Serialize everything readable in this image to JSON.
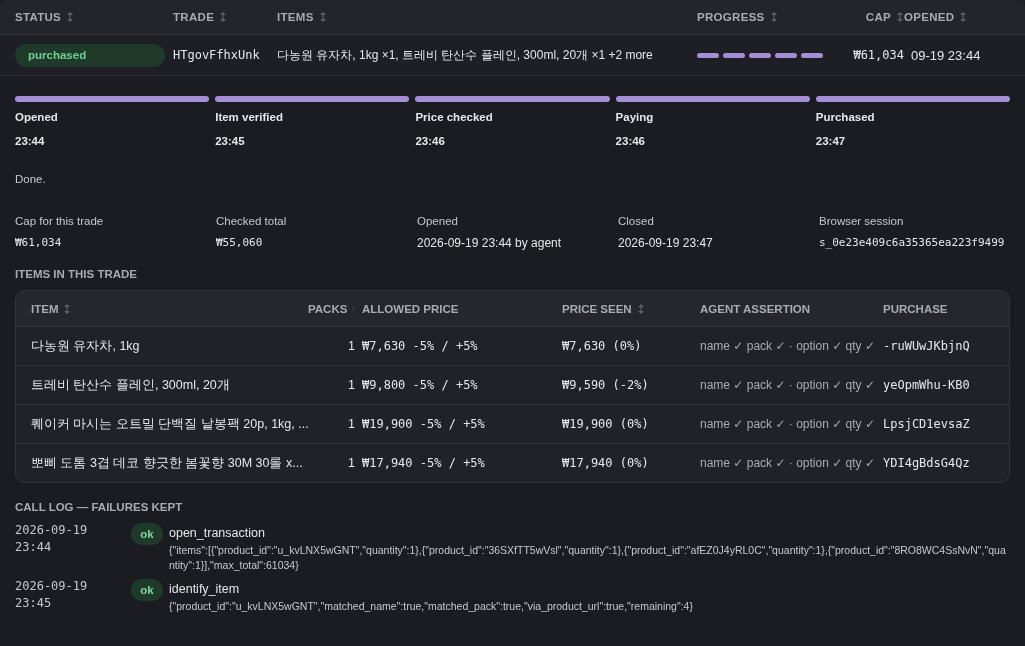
{
  "trades_table": {
    "columns": [
      {
        "label": "STATUS",
        "sortable": true
      },
      {
        "label": "TRADE",
        "sortable": true
      },
      {
        "label": "ITEMS",
        "sortable": true
      },
      {
        "label": "PROGRESS",
        "sortable": true
      },
      {
        "label": "CAP",
        "sortable": true
      },
      {
        "label": "OPENED",
        "sortable": true
      }
    ],
    "rows": [
      {
        "status": "purchased",
        "trade": "HTgovFfhxUnk",
        "items": "다농원 유자차, 1kg ×1, 트레비 탄산수 플레인, 300ml, 20개 ×1 +2 more",
        "progress": [
          {
            "done": true
          },
          {
            "done": true
          },
          {
            "done": true
          },
          {
            "done": true
          },
          {
            "done": true
          }
        ],
        "cap": "₩61,034",
        "opened": "09-19 23:44"
      }
    ]
  },
  "detail": {
    "steps": [
      {
        "label": "Opened",
        "time": "23:44",
        "done": true
      },
      {
        "label": "Item verified",
        "time": "23:45",
        "done": true
      },
      {
        "label": "Price checked",
        "time": "23:46",
        "done": true
      },
      {
        "label": "Paying",
        "time": "23:46",
        "done": true
      },
      {
        "label": "Purchased",
        "time": "23:47",
        "done": true
      }
    ],
    "message": "Done.",
    "facts": [
      {
        "label": "Cap for this trade",
        "value": "₩61,034",
        "mono": true
      },
      {
        "label": "Checked total",
        "value": "₩55,060",
        "mono": true
      },
      {
        "label": "Opened",
        "value": "2026-09-19 23:44 by agent",
        "mono": false
      },
      {
        "label": "Closed",
        "value": "2026-09-19 23:47",
        "mono": false
      },
      {
        "label": "Browser session",
        "value": "s_0e23e409c6a35365ea223f9499",
        "mono": true
      }
    ],
    "items_heading": "ITEMS IN THIS TRADE",
    "items_table": {
      "columns": [
        {
          "label": "ITEM",
          "sortable": true
        },
        {
          "label": "PACKS",
          "sortable": true
        },
        {
          "label": "ALLOWED PRICE",
          "sortable": false
        },
        {
          "label": "PRICE SEEN",
          "sortable": true
        },
        {
          "label": "AGENT ASSERTION",
          "sortable": false
        },
        {
          "label": "PURCHASE",
          "sortable": false
        }
      ],
      "rows": [
        {
          "item": "다농원 유자차, 1kg",
          "packs": "1",
          "allowed": "₩7,630 -5% / +5%",
          "seen": "₩7,630 (0%)",
          "assertion": "name ✓ pack ✓ · option ✓ qty ✓",
          "purchase": "-ruWUwJKbjnQ"
        },
        {
          "item": "트레비 탄산수 플레인, 300ml, 20개",
          "packs": "1",
          "allowed": "₩9,800 -5% / +5%",
          "seen": "₩9,590 (-2%)",
          "assertion": "name ✓ pack ✓ · option ✓ qty ✓",
          "purchase": "yeOpmWhu-KB0"
        },
        {
          "item": "퀘이커 마시는 오트밀 단백질 낱봉팩 20p, 1kg, ...",
          "packs": "1",
          "allowed": "₩19,900 -5% / +5%",
          "seen": "₩19,900 (0%)",
          "assertion": "name ✓ pack ✓ · option ✓ qty ✓",
          "purchase": "LpsjCD1evsaZ"
        },
        {
          "item": "뽀삐 도톰 3겹 데코 향긋한 봄꽃향 30M 30롤 x...",
          "packs": "1",
          "allowed": "₩17,940 -5% / +5%",
          "seen": "₩17,940 (0%)",
          "assertion": "name ✓ pack ✓ · option ✓ qty ✓",
          "purchase": "YDI4gBdsG4Qz"
        }
      ]
    },
    "log_heading": "CALL LOG — FAILURES KEPT",
    "log": [
      {
        "date": "2026-09-19",
        "time": "23:44",
        "result": "ok",
        "call": "open_transaction",
        "args": "{\"items\":[{\"product_id\":\"u_kvLNX5wGNT\",\"quantity\":1},{\"product_id\":\"36SXfTT5wVsl\",\"quantity\":1},{\"product_id\":\"afEZ0J4yRL0C\",\"quantity\":1},{\"product_id\":\"8RO8WC4SsNvN\",\"quantity\":1}],\"max_total\":61034}"
      },
      {
        "date": "2026-09-19",
        "time": "23:45",
        "result": "ok",
        "call": "identify_item",
        "args": "{\"product_id\":\"u_kvLNX5wGNT\",\"matched_name\":true,\"matched_pack\":true,\"via_product_url\":true,\"remaining\":4}"
      }
    ]
  }
}
